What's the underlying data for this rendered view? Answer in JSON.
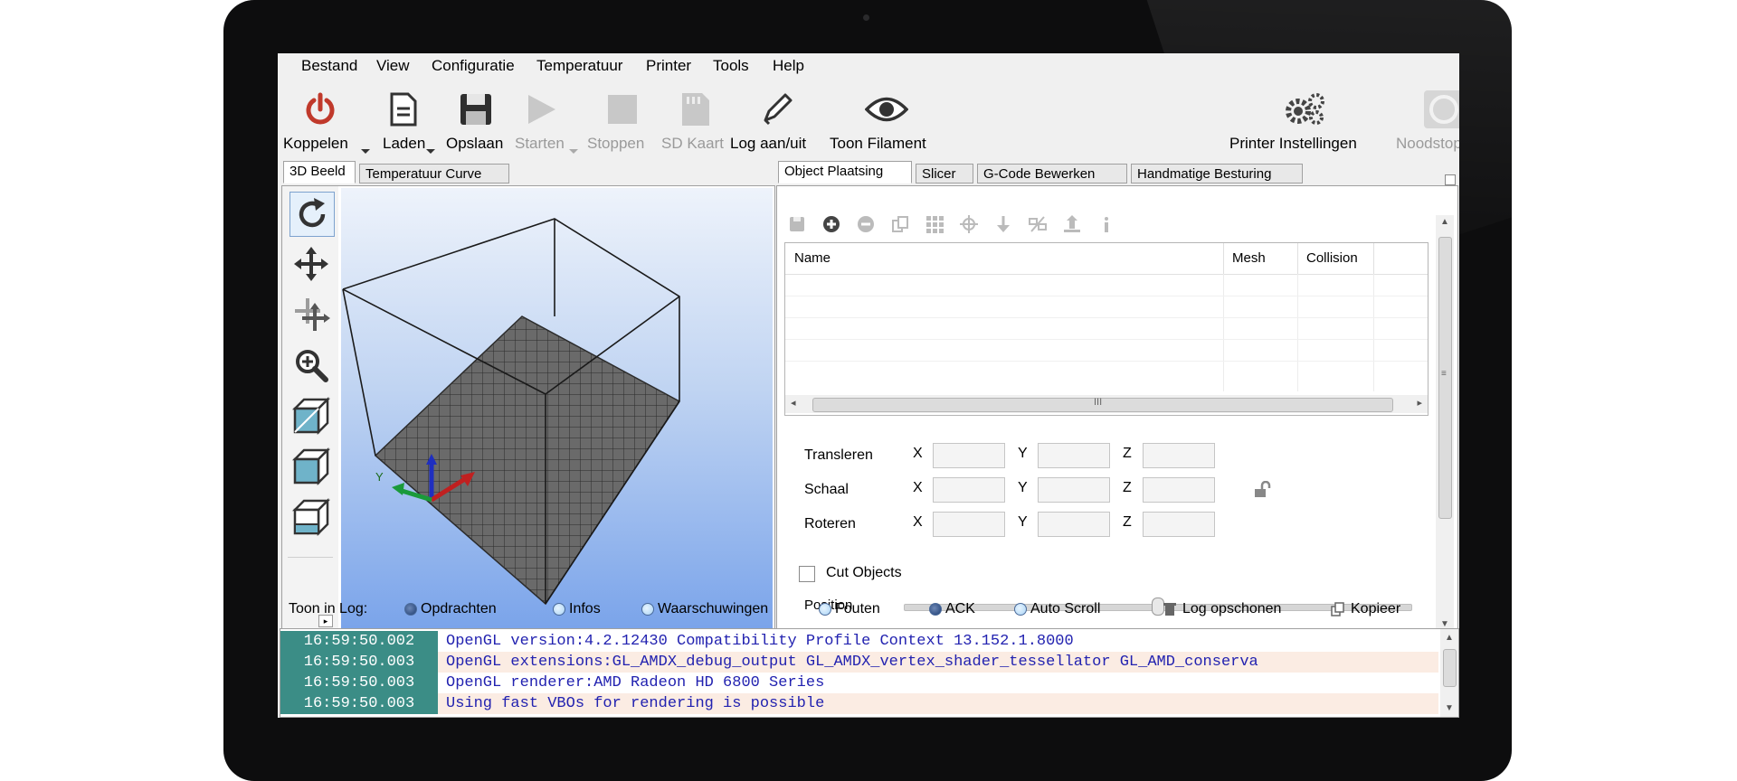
{
  "menu": [
    "Bestand",
    "View",
    "Configuratie",
    "Temperatuur",
    "Printer",
    "Tools",
    "Help"
  ],
  "toolbar": {
    "connect": "Koppelen",
    "load": "Laden",
    "save": "Opslaan",
    "start": "Starten",
    "stop": "Stoppen",
    "sdcard": "SD Kaart",
    "log": "Log aan/uit",
    "filament": "Toon Filament",
    "printer_settings": "Printer Instellingen",
    "emergency": "Noodstop"
  },
  "left_tabs": [
    "3D Beeld",
    "Temperatuur Curve"
  ],
  "right_tabs": [
    "Object Plaatsing",
    "Slicer",
    "G-Code Bewerken",
    "Handmatige Besturing"
  ],
  "object_grid": {
    "columns": [
      "Name",
      "Mesh",
      "Collision"
    ],
    "scroll_grip": "III"
  },
  "transform": {
    "rows": [
      "Transleren",
      "Schaal",
      "Roteren"
    ],
    "axes": [
      "X",
      "Y",
      "Z"
    ]
  },
  "cut_objects": "Cut Objects",
  "position_label": "Position",
  "log_bar": {
    "label": "Toon in Log:",
    "commands": "Opdrachten",
    "infos": "Infos",
    "warnings": "Waarschuwingen",
    "errors": "Fouten",
    "ack": "ACK",
    "autoscroll": "Auto Scroll",
    "clear": "Log opschonen",
    "copy": "Kopieer"
  },
  "log": [
    {
      "time": "16:59:50.002",
      "msg": "OpenGL version:4.2.12430 Compatibility Profile Context 13.152.1.8000"
    },
    {
      "time": "16:59:50.003",
      "msg": "OpenGL extensions:GL_AMDX_debug_output GL_AMDX_vertex_shader_tessellator GL_AMD_conserva"
    },
    {
      "time": "16:59:50.003",
      "msg": "OpenGL renderer:AMD Radeon HD 6800 Series"
    },
    {
      "time": "16:59:50.003",
      "msg": "Using fast VBOs for rendering is possible"
    }
  ],
  "colors": {
    "accent_red": "#c0392b",
    "timestamp_bg": "#3b8d86",
    "log_text": "#2222b0",
    "viewport_blue": "#79a3ea"
  }
}
